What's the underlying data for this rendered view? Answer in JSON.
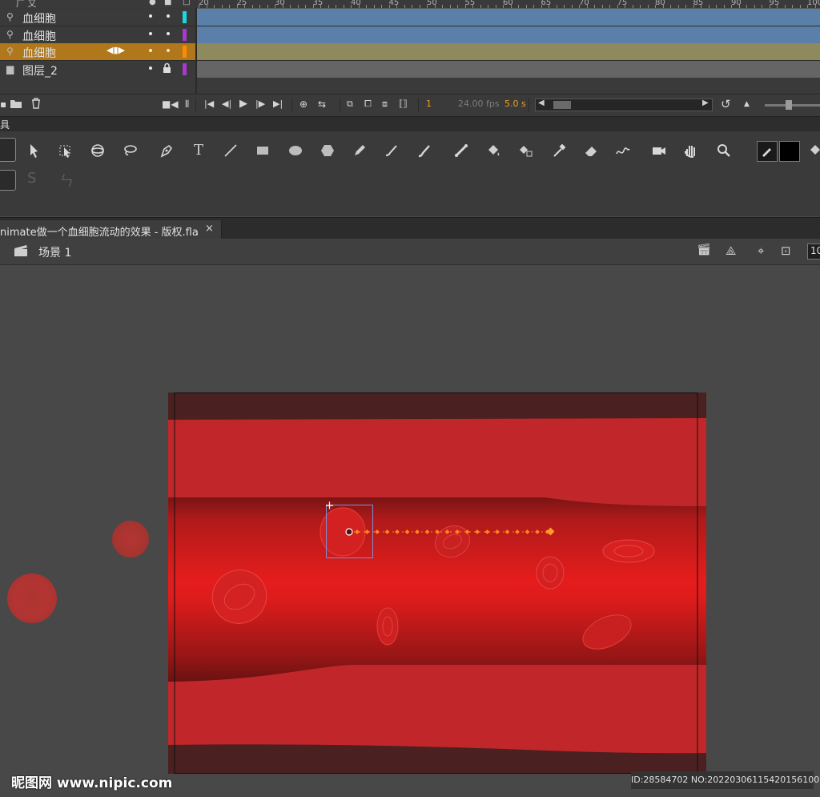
{
  "timeline": {
    "ruler_numbers": [
      "20",
      "25",
      "30",
      "35",
      "40",
      "45",
      "50",
      "55",
      "60",
      "65",
      "70",
      "75",
      "80",
      "85",
      "90",
      "95",
      "100"
    ],
    "layers": [
      {
        "name": "血细胞",
        "color": "#19d8e0",
        "selected": false,
        "locked": false
      },
      {
        "name": "血细胞",
        "color": "#a838d0",
        "selected": false,
        "locked": false
      },
      {
        "name": "血细胞",
        "color": "#ff8a00",
        "selected": true,
        "locked": false
      },
      {
        "name": "图层_2",
        "color": "#a838d0",
        "selected": false,
        "locked": true
      }
    ],
    "frame_colors": [
      "#5a7fa8",
      "#5a7fa8",
      "#8f8a5e",
      "#656565"
    ],
    "current_frame": "1",
    "fps": "24.00 fps",
    "time": "5.0 s"
  },
  "tools_panel": {
    "header_label": "具",
    "tools": [
      "selection-tool",
      "subselection-tool",
      "free-transform-tool",
      "3d-rotation-tool",
      "lasso-tool",
      "pen-tool",
      "text-tool",
      "line-tool",
      "rectangle-tool",
      "oval-tool",
      "polystar-tool",
      "pencil-tool",
      "paint-brush-tool",
      "brush-tool",
      "bone-tool",
      "paint-bucket-tool",
      "ink-bottle-tool",
      "eyedropper-tool",
      "eraser-tool",
      "width-tool",
      "camera-tool",
      "hand-tool",
      "zoom-tool",
      "stroke-color",
      "fill-color"
    ],
    "stroke_color": "#000000",
    "fill_color": "#000000"
  },
  "document": {
    "tab_label": "nimate做一个血细胞流动的效果 - 版权.fla",
    "close_label": "×",
    "scene_label": "场景 1",
    "zoom_value": "10"
  },
  "stage": {
    "vessel_wall_color": "#c1272a",
    "lumen_color": "#e31b1b",
    "dark_band_color": "#4a2020",
    "motion_path_color": "#ff8a1c"
  },
  "watermark": {
    "logo": "昵图网 www.nipic.com",
    "id_text": "ID:28584702 NO:20220306115420156100"
  }
}
